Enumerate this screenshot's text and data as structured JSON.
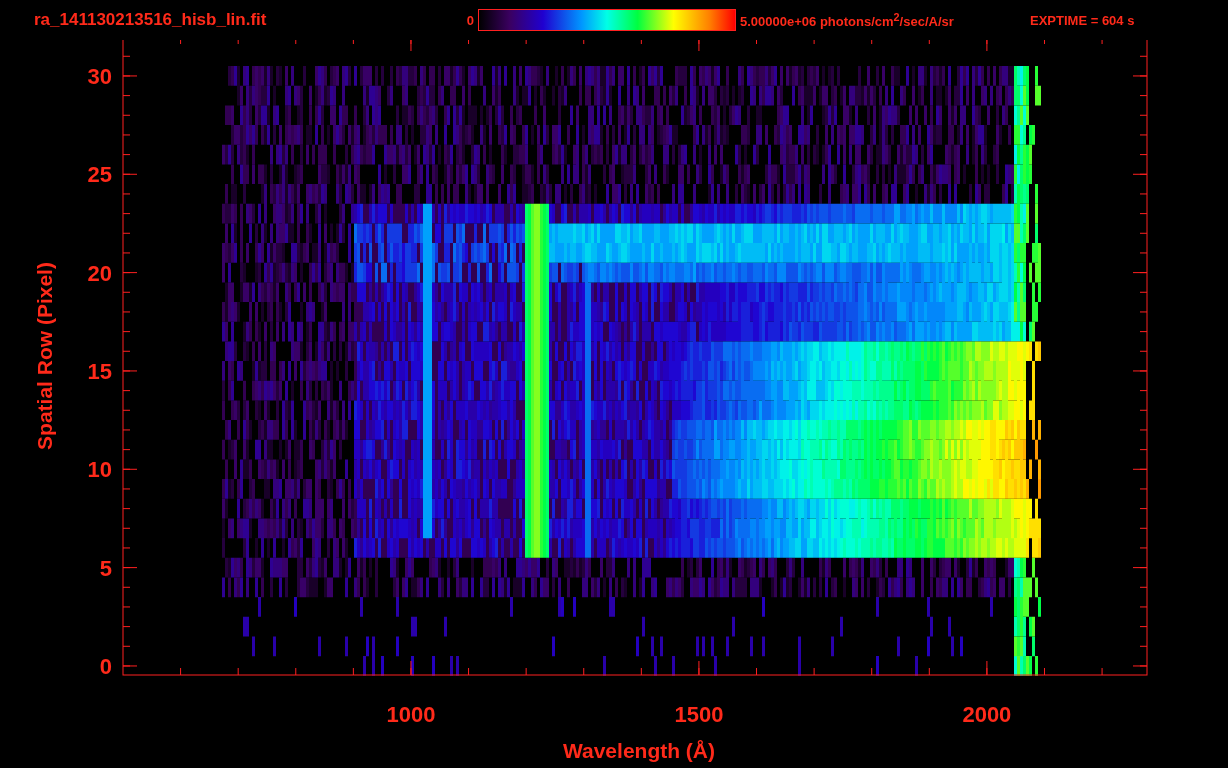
{
  "header": {
    "filename": "ra_141130213516_hisb_lin.fit",
    "colorbar_min": "0",
    "colorbar_max": "5.00000e+06 photons/cm$^{2}$/sec/A/sr",
    "exposure": "EXPTIME = 604 s"
  },
  "plot": {
    "ylabel": "Spatial Row (Pixel)",
    "yticks": [
      "30",
      "25",
      "20",
      "15",
      "10",
      "5",
      "0"
    ],
    "xticks": [
      "1000",
      "1500",
      "2000"
    ],
    "xlabel": "Wavelength (Å)"
  }
}
